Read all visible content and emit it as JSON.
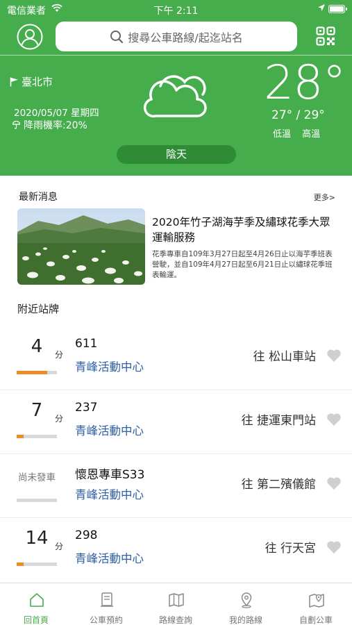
{
  "status_bar": {
    "carrier": "電信業者",
    "time": "下午 2:11"
  },
  "header": {
    "search_placeholder": "搜尋公車路線/起迄站名"
  },
  "weather": {
    "city": "臺北市",
    "date": "2020/05/07 星期四",
    "rain_chance": "降雨機率:20%",
    "temperature": "28°",
    "range": "27° / 29°",
    "low_label": "低溫",
    "high_label": "高溫",
    "condition": "陰天"
  },
  "news": {
    "section_title": "最新消息",
    "more_label": "更多>",
    "headline": "2020年竹子湖海芋季及繡球花季大眾運輸服務",
    "body": "花季專車自109年3月27日起至4月26日止以海芋季班表營駛，並自109年4月27日起至6月21日止以繡球花季班表輸運。"
  },
  "nearby": {
    "section_title": "附近站牌",
    "minute_unit": "分",
    "items": [
      {
        "minutes": "4",
        "status": "",
        "route": "611",
        "stop": "青峰活動中心",
        "destination": "往 松山車站",
        "progress": 0.75
      },
      {
        "minutes": "7",
        "status": "",
        "route": "237",
        "stop": "青峰活動中心",
        "destination": "往 捷運東門站",
        "progress": 0.17
      },
      {
        "minutes": "",
        "status": "尚未發車",
        "route": "懷恩專車S33",
        "stop": "青峰活動中心",
        "destination": "往 第二殯儀館",
        "progress": 0
      },
      {
        "minutes": "14",
        "status": "",
        "route": "298",
        "stop": "青峰活動中心",
        "destination": "往 行天宮",
        "progress": 0.17
      }
    ]
  },
  "tabs": [
    {
      "label": "回首頁",
      "icon": "home-icon",
      "active": true
    },
    {
      "label": "公車預約",
      "icon": "reservation-icon",
      "active": false
    },
    {
      "label": "路線查詢",
      "icon": "route-map-icon",
      "active": false
    },
    {
      "label": "我的路線",
      "icon": "location-pin-icon",
      "active": false
    },
    {
      "label": "自劃公車",
      "icon": "custom-map-icon",
      "active": false
    }
  ],
  "colors": {
    "brand_green": "#46ad4c",
    "condition_pill": "#2f8b36",
    "stop_blue": "#2f5fa8",
    "progress_orange": "#f08a24"
  }
}
